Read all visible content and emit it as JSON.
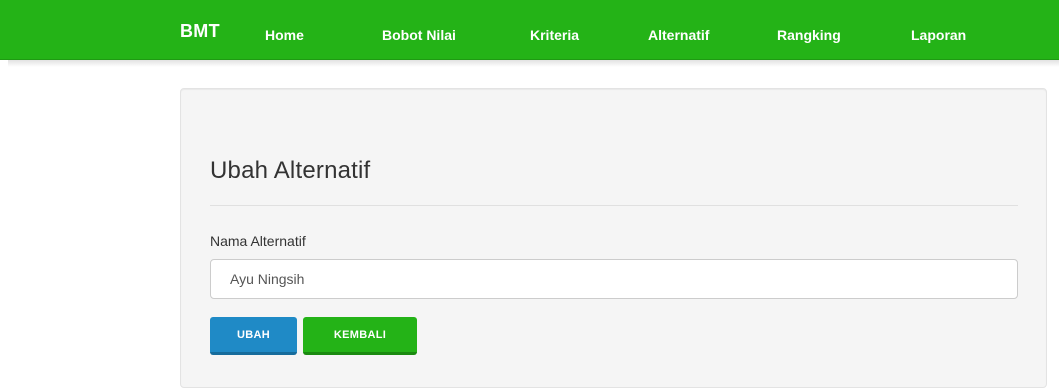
{
  "navbar": {
    "brand": "BMT",
    "links": [
      "Home",
      "Bobot Nilai",
      "Kriteria",
      "Alternatif",
      "Rangking",
      "Laporan"
    ]
  },
  "form": {
    "title": "Ubah Alternatif",
    "field_label": "Nama Alternatif",
    "field_value": "Ayu Ningsih",
    "submit_label": "UBAH",
    "back_label": "KEMBALI"
  },
  "colors": {
    "navbar": "#24b317",
    "primary_button": "#1f8ac6",
    "success_button": "#24b317",
    "panel_background": "#f5f5f5"
  }
}
